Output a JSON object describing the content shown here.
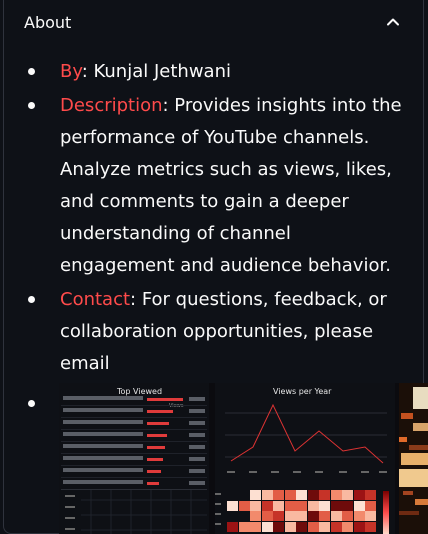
{
  "expander": {
    "title": "About",
    "expanded": true,
    "chevron": "chevron-up-icon"
  },
  "items": [
    {
      "key": "By",
      "text": ": Kunjal Jethwani"
    },
    {
      "key": "Description",
      "text": ": Provides insights into the performance of YouTube channels. Analyze metrics such as views, likes, and comments to gain a deeper understanding of channel engagement and audience behavior."
    },
    {
      "key": "Contact",
      "text": ": For questions, feedback, or collaboration opportunities, please email"
    }
  ],
  "preview": {
    "left_title": "Top Viewed",
    "left_column": "Views",
    "mid_title": "Views per Year"
  },
  "colors": {
    "accent": "#ff4b4b",
    "link": "#1c83e1",
    "background": "#0e1117"
  }
}
